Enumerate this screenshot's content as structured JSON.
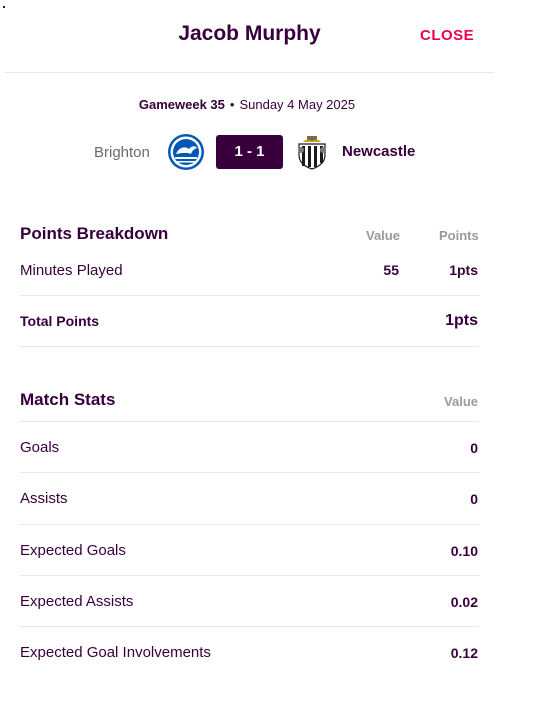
{
  "header": {
    "player_name": "Jacob Murphy",
    "close_label": "CLOSE"
  },
  "fixture": {
    "gameweek": "Gameweek 35",
    "date": "Sunday 4 May 2025",
    "separator": "•",
    "home_team": "Brighton",
    "home_badge_icon": "brighton-crest-icon",
    "score": "1 - 1",
    "away_team": "Newcastle",
    "away_badge_icon": "newcastle-crest-icon"
  },
  "points_breakdown": {
    "title": "Points Breakdown",
    "col_value": "Value",
    "col_points": "Points",
    "rows": [
      {
        "label": "Minutes Played",
        "value": "55",
        "points": "1pts"
      }
    ],
    "total_label": "Total Points",
    "total_points": "1pts"
  },
  "match_stats": {
    "title": "Match Stats",
    "col_value": "Value",
    "rows": [
      {
        "label": "Goals",
        "value": "0"
      },
      {
        "label": "Assists",
        "value": "0"
      },
      {
        "label": "Expected Goals",
        "value": "0.10"
      },
      {
        "label": "Expected Assists",
        "value": "0.02"
      },
      {
        "label": "Expected Goal Involvements",
        "value": "0.12"
      }
    ]
  },
  "colors": {
    "primary": "#37003c",
    "accent": "#e90052",
    "muted": "#9a9a9a",
    "divider": "#e6e6e6"
  }
}
